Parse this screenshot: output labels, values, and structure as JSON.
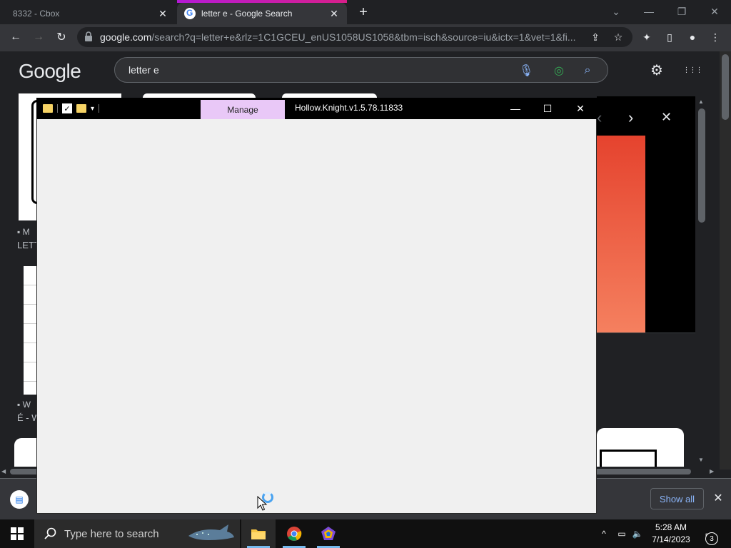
{
  "browser": {
    "tabs": [
      {
        "title": "8332 - Cbox",
        "close": "✕"
      },
      {
        "title": "letter e - Google Search",
        "close": "✕"
      }
    ],
    "new_tab": "+",
    "window_controls": {
      "dropdown": "⌄",
      "minimize": "—",
      "restore": "❐",
      "close": "✕"
    },
    "nav": {
      "back": "←",
      "forward": "→",
      "reload": "↻"
    },
    "url_host": "google.com",
    "url_rest": "/search?q=letter+e&rlz=1C1GCEU_enUS1058US1058&tbm=isch&source=iu&ictx=1&vet=1&fi...",
    "toolbar_icons": {
      "share": "⇪",
      "bookmark": "☆",
      "extensions": "✦",
      "sidepanel": "▯",
      "profile": "●",
      "menu": "⋮"
    }
  },
  "google": {
    "logo": "Google",
    "query": "letter e",
    "mic": "🎙",
    "lens": "◎",
    "search": "⌕",
    "settings": "⚙",
    "apps": "⋮⋮⋮",
    "panel_prev": "‹",
    "panel_next": "›",
    "panel_close": "✕",
    "left_captions": [
      {
        "source": "M",
        "title": "LETT"
      },
      {
        "source": "W",
        "title": "É - W"
      }
    ]
  },
  "download_bar": {
    "show_all": "Show all",
    "close": "✕"
  },
  "explorer": {
    "manage_tab": "Manage",
    "title": "Hollow.Knight.v1.5.78.11833",
    "controls": {
      "minimize": "—",
      "maximize": "☐",
      "close": "✕"
    },
    "qa_arrow": "▾"
  },
  "taskbar": {
    "search_placeholder": "Type here to search",
    "time": "5:28 AM",
    "date": "7/14/2023",
    "notification_count": "3",
    "tray_up": "^"
  },
  "colors": {
    "manage_accent": "#e9c8f7",
    "active_tab_accent": "#b41ad6",
    "taskbar_active": "#76b9ed"
  }
}
